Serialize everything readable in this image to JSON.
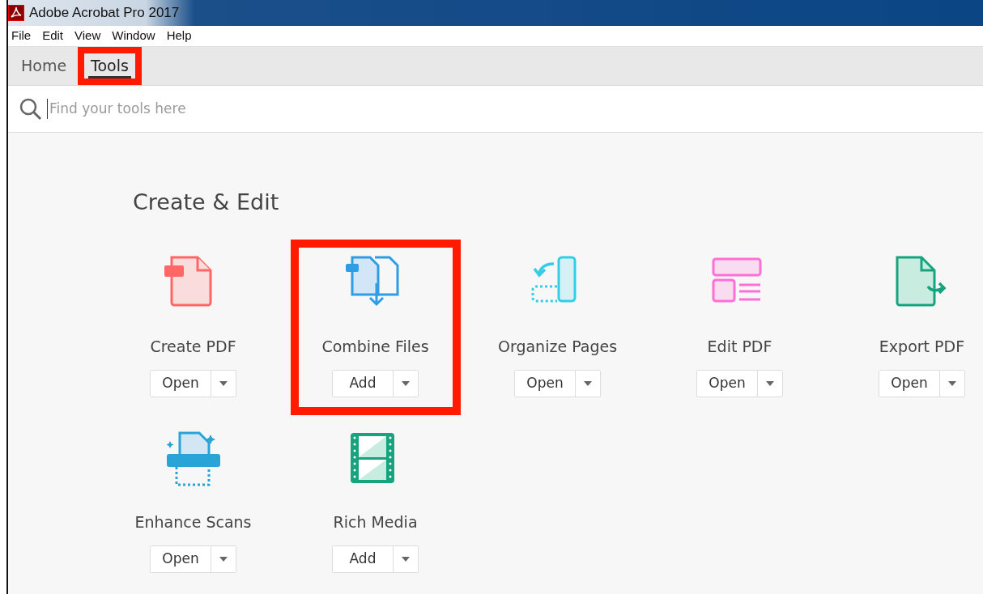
{
  "window": {
    "title": "Adobe Acrobat Pro 2017"
  },
  "menu": [
    "File",
    "Edit",
    "View",
    "Window",
    "Help"
  ],
  "tabs": [
    {
      "label": "Home",
      "selected": false,
      "highlighted": false
    },
    {
      "label": "Tools",
      "selected": true,
      "highlighted": true
    }
  ],
  "search": {
    "placeholder": "Find your tools here"
  },
  "section": {
    "title": "Create & Edit"
  },
  "tools": [
    {
      "name": "Create PDF",
      "kind": "create",
      "action": "Open",
      "highlighted": false
    },
    {
      "name": "Combine Files",
      "kind": "combine",
      "action": "Add",
      "highlighted": true
    },
    {
      "name": "Organize Pages",
      "kind": "organize",
      "action": "Open",
      "highlighted": false
    },
    {
      "name": "Edit PDF",
      "kind": "edit",
      "action": "Open",
      "highlighted": false
    },
    {
      "name": "Export PDF",
      "kind": "export",
      "action": "Open",
      "highlighted": false
    },
    {
      "name": "Enhance Scans",
      "kind": "scan",
      "action": "Open",
      "highlighted": false
    },
    {
      "name": "Rich Media",
      "kind": "media",
      "action": "Add",
      "highlighted": false
    }
  ]
}
